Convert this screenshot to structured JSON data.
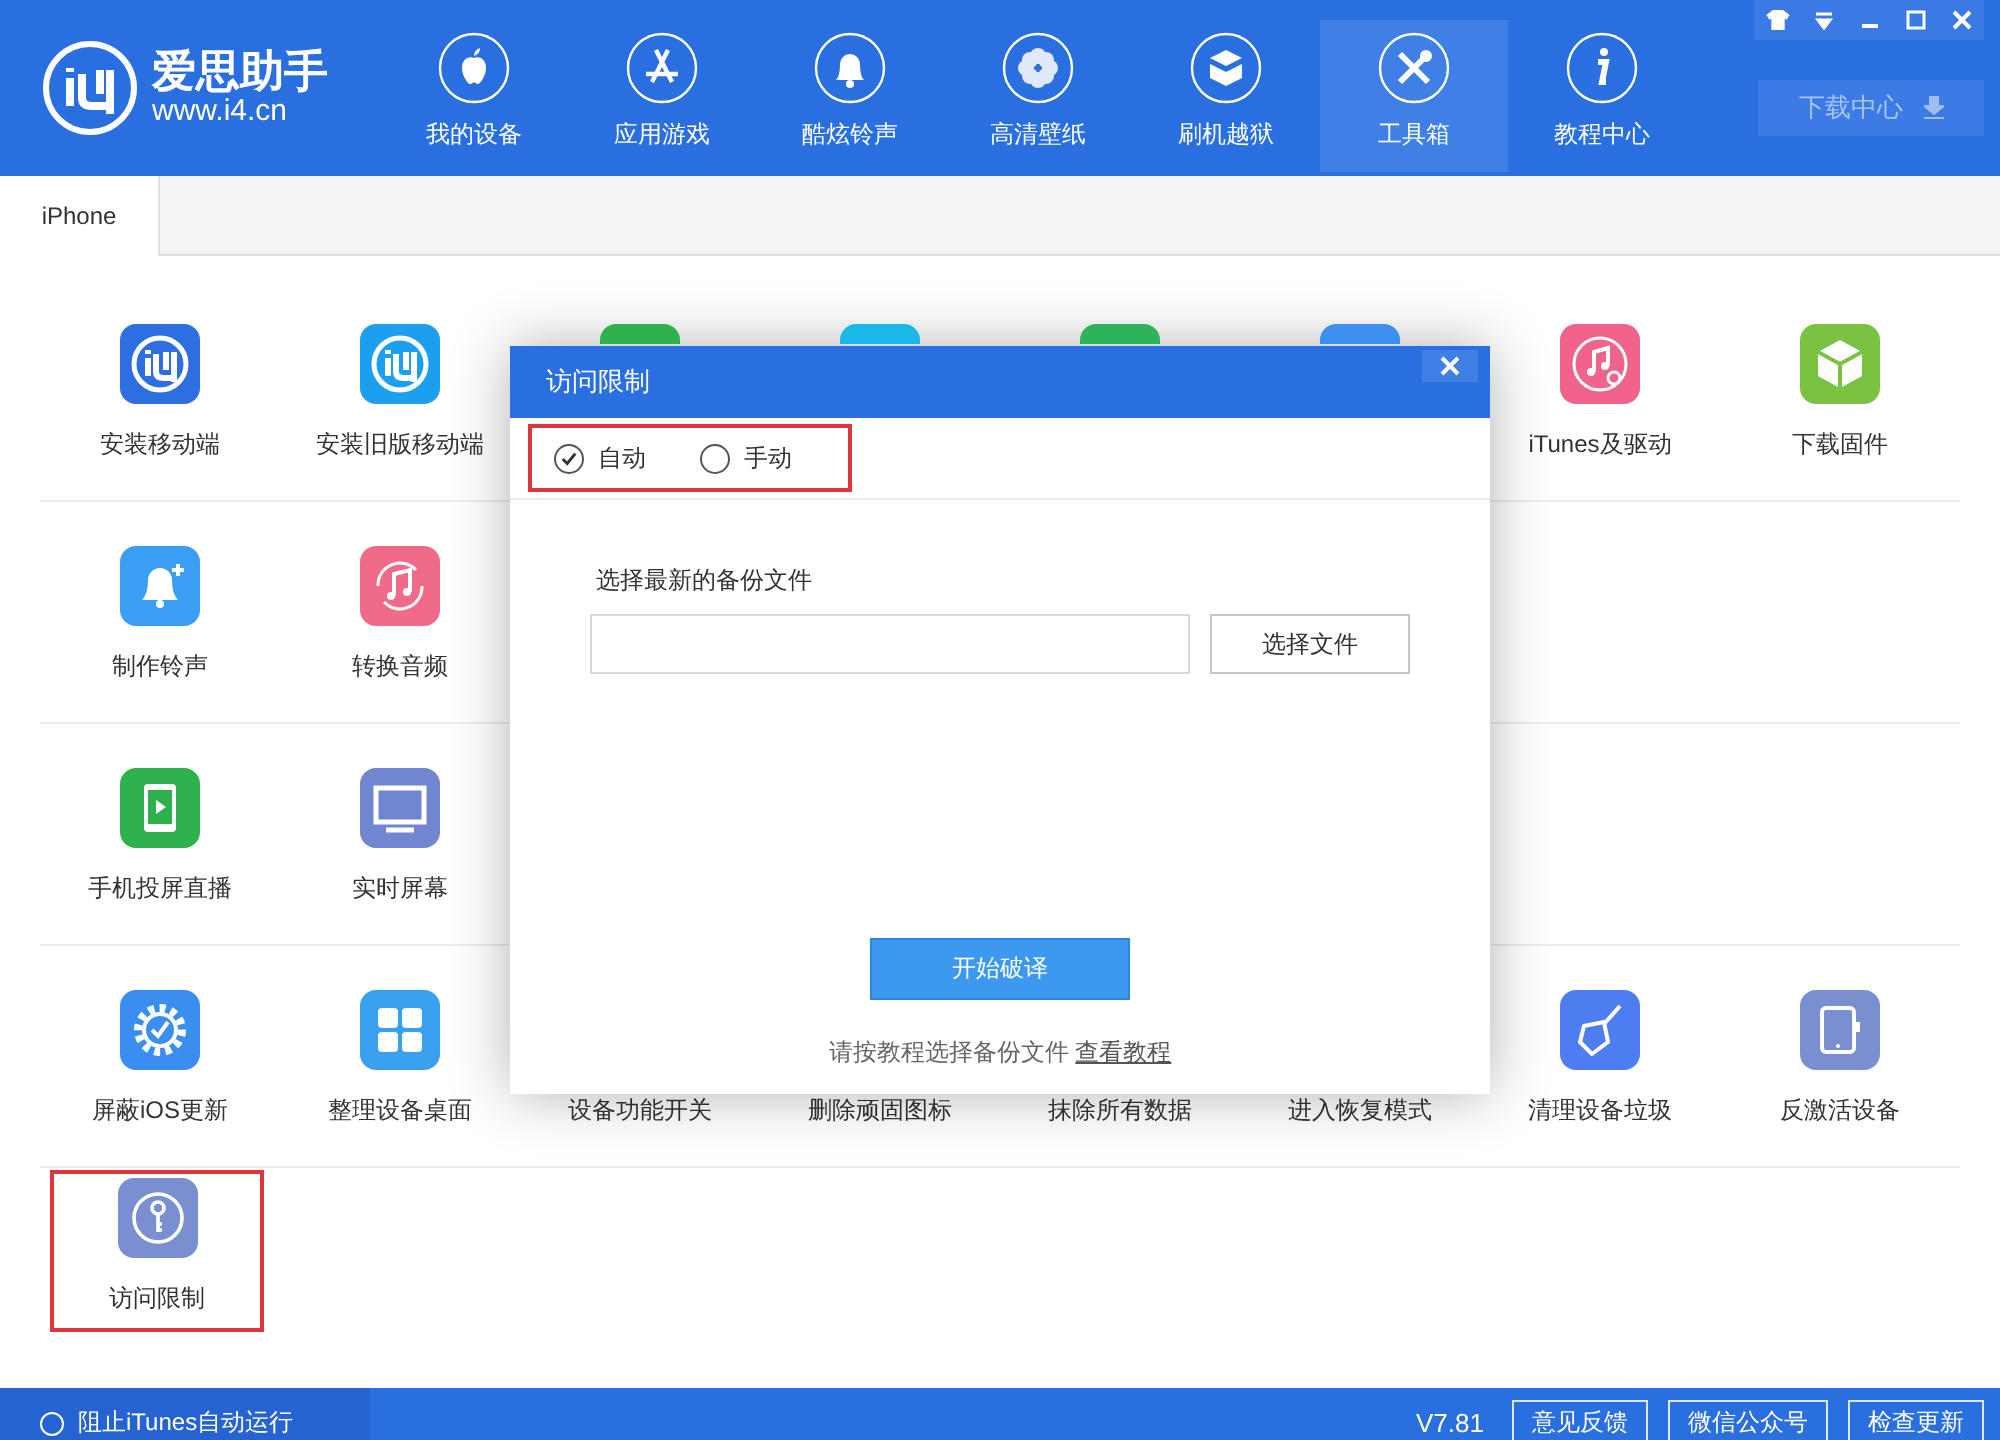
{
  "app": {
    "name": "爱思助手",
    "url": "www.i4.cn"
  },
  "nav": [
    {
      "label": "我的设备",
      "kind": "apple",
      "selected": false
    },
    {
      "label": "应用游戏",
      "kind": "appstore",
      "selected": false
    },
    {
      "label": "酷炫铃声",
      "kind": "bell",
      "selected": false
    },
    {
      "label": "高清壁纸",
      "kind": "flower",
      "selected": false
    },
    {
      "label": "刷机越狱",
      "kind": "box",
      "selected": false
    },
    {
      "label": "工具箱",
      "kind": "tools",
      "selected": true
    },
    {
      "label": "教程中心",
      "kind": "info",
      "selected": false
    }
  ],
  "download_center": {
    "label": "下载中心"
  },
  "tabs": [
    {
      "label": "iPhone",
      "selected": true
    }
  ],
  "tools": [
    [
      {
        "label": "安装移动端",
        "kind": "i4",
        "color": "#2d6fe0",
        "highlighted": false
      },
      {
        "label": "安装旧版移动端",
        "kind": "i4",
        "color": "#1d9ff0",
        "highlighted": false
      },
      {
        "kind": "covered",
        "color": "#2db04d",
        "highlighted": false
      },
      {
        "kind": "covered",
        "color": "#1ab8e8",
        "highlighted": false
      },
      {
        "kind": "covered",
        "color": "#2db45a",
        "highlighted": false
      },
      {
        "kind": "covered",
        "color": "#3d8ff0",
        "highlighted": false
      },
      {
        "label": "iTunes及驱动",
        "kind": "music-gear",
        "color": "#f0648c",
        "highlighted": false
      },
      {
        "label": "下载固件",
        "kind": "cube",
        "color": "#7cc242",
        "highlighted": false
      }
    ],
    [
      {
        "label": "制作铃声",
        "kind": "bell",
        "color": "#3a9ef5",
        "highlighted": false
      },
      {
        "label": "转换音频",
        "kind": "music",
        "color": "#f06b8a",
        "highlighted": false
      }
    ],
    [
      {
        "label": "手机投屏直播",
        "kind": "tablet-play",
        "color": "#2db04d",
        "highlighted": false
      },
      {
        "label": "实时屏幕",
        "kind": "monitor",
        "color": "#7086d0",
        "highlighted": false
      }
    ],
    [
      {
        "label": "屏蔽iOS更新",
        "kind": "gear",
        "color": "#3a8ef0",
        "highlighted": false
      },
      {
        "label": "整理设备桌面",
        "kind": "grid",
        "color": "#3aa0f0",
        "highlighted": false
      },
      {
        "label": "设备功能开关",
        "highlighted": false
      },
      {
        "label": "删除顽固图标",
        "highlighted": false
      },
      {
        "label": "抹除所有数据",
        "highlighted": false
      },
      {
        "label": "进入恢复模式",
        "highlighted": false
      },
      {
        "label": "清理设备垃圾",
        "kind": "broom",
        "color": "#4d7df0",
        "highlighted": false
      },
      {
        "label": "反激活设备",
        "kind": "tablet",
        "color": "#7a8fd0",
        "highlighted": false
      }
    ],
    [
      {
        "label": "访问限制",
        "kind": "key",
        "color": "#7a8fd0",
        "highlighted": true
      }
    ]
  ],
  "dialog": {
    "title": "访问限制",
    "modes": [
      {
        "label": "自动",
        "selected": true
      },
      {
        "label": "手动",
        "selected": false
      }
    ],
    "modes_highlighted": true,
    "file_label": "选择最新的备份文件",
    "browse_button": "选择文件",
    "start_button": "开始破译",
    "hint": "请按教程选择备份文件",
    "hint_link": "查看教程"
  },
  "status_bar": {
    "itunes_block": {
      "label": "阻止iTunes自动运行",
      "checked": false
    },
    "version": "V7.81",
    "buttons": [
      "意见反馈",
      "微信公众号",
      "检查更新"
    ]
  }
}
